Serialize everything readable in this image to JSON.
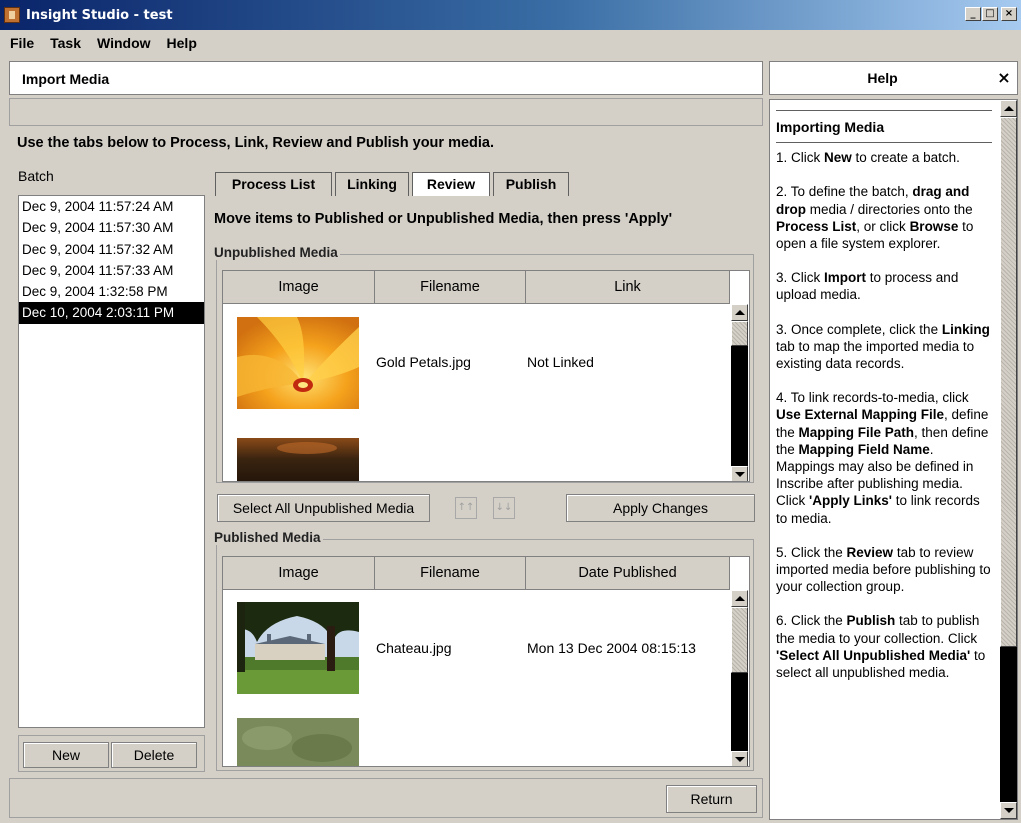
{
  "window": {
    "title": "Insight Studio - test"
  },
  "menu": [
    "File",
    "Task",
    "Window",
    "Help"
  ],
  "header": {
    "title": "Import Media"
  },
  "instruction": "Use the tabs below to Process, Link, Review and Publish your media.",
  "batch": {
    "label": "Batch",
    "items": [
      "Dec 9, 2004 11:57:24 AM",
      "Dec 9, 2004 11:57:30 AM",
      "Dec 9, 2004 11:57:32 AM",
      "Dec 9, 2004 11:57:33 AM",
      "Dec 9, 2004 1:32:58 PM",
      "Dec 10, 2004 2:03:11 PM"
    ],
    "selected_index": 5,
    "new_label": "New",
    "delete_label": "Delete"
  },
  "tabs": [
    "Process List",
    "Linking",
    "Review",
    "Publish"
  ],
  "active_tab": "Review",
  "review": {
    "title": "Move items to Published or Unpublished Media, then press 'Apply'",
    "unpublished": {
      "label": "Unpublished Media",
      "columns": [
        "Image",
        "Filename",
        "Link"
      ],
      "rows": [
        {
          "image": "flower-petals-thumbnail",
          "filename": "Gold Petals.jpg",
          "link": "Not Linked"
        }
      ]
    },
    "select_all_label": "Select All Unpublished Media",
    "move_up_label": "↑↑",
    "move_down_label": "↓↓",
    "apply_label": "Apply Changes",
    "published": {
      "label": "Published Media",
      "columns": [
        "Image",
        "Filename",
        "Date Published"
      ],
      "rows": [
        {
          "image": "chateau-thumbnail",
          "filename": "Chateau.jpg",
          "date": "Mon 13 Dec 2004 08:15:13"
        }
      ]
    }
  },
  "return_label": "Return",
  "help": {
    "title": "Help",
    "close": "×",
    "heading": "Importing Media"
  },
  "colors": {
    "selection": "#000000",
    "titlebar_start": "#0a246a",
    "titlebar_end": "#a6caf0",
    "background": "#d4d0c8"
  }
}
